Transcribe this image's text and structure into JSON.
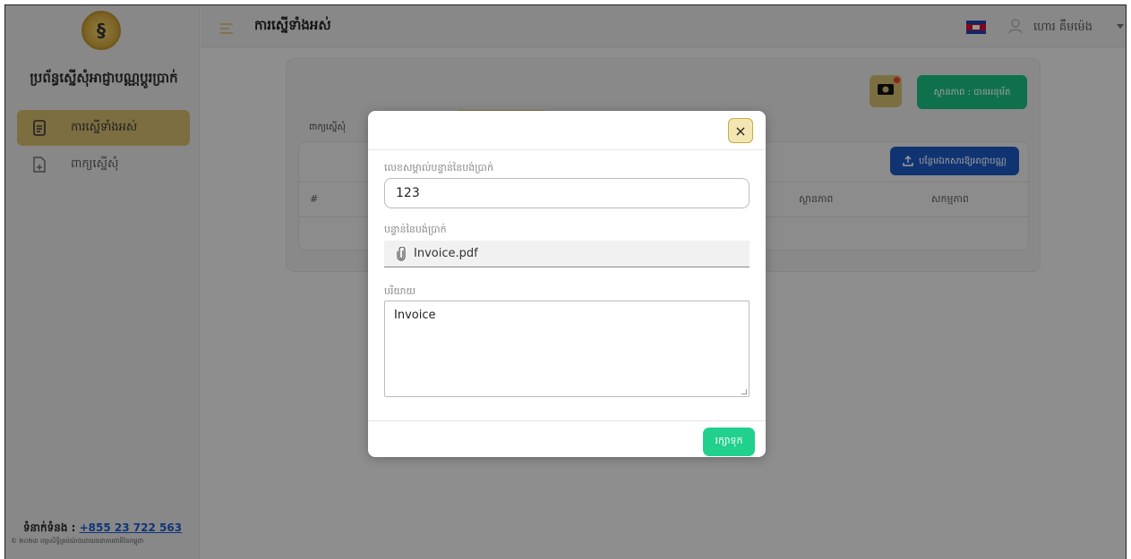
{
  "sidebar": {
    "logo_text": "§",
    "app_title": "ប្រព័ន្ធស្នើសុំអាជ្ញាបណ្ណប្តូរប្រាក់",
    "items": [
      {
        "label": "ការស្នើទាំងអស់",
        "icon": "document-icon",
        "active": true
      },
      {
        "label": "ពាក្យស្នើសុំ",
        "icon": "file-add-icon",
        "active": false
      }
    ],
    "contact_label": "ទំនាក់ទំនង : ",
    "contact_phone": "+855 23 722 563",
    "copyright": "© ២០២៣ រក្សាសិទ្ធិគ្រប់យ៉ាងដោយធនាគារជាតិនៃកម្ពុជា"
  },
  "topbar": {
    "title": "ការស្នើទាំងអស់",
    "user_name": "ហោរ គឹមម៉េង",
    "flag": "cambodia-flag-icon"
  },
  "card": {
    "status_button": "ស្ថានភាព : បានអនុម័ត",
    "tab_label": "ពាក្យស្នើសុំ",
    "upload_button": "បន្ថែមឯកសារឱ្យអាជ្ញាបណ្ណ",
    "columns": [
      "#",
      "ស្ថានភាព",
      "សកម្មភាព"
    ]
  },
  "modal": {
    "field1_label": "លេខសម្គាល់បន្ទាន់នៃបង់ប្រាក់",
    "field1_value": "123",
    "field2_label": "បន្ទាន់នៃបង់ប្រាក់",
    "file_name": "Invoice.pdf",
    "field3_label": "បរិយាយ",
    "description": "Invoice",
    "save_button": "រក្សាទុក",
    "close_symbol": "×"
  },
  "colors": {
    "accent_gold": "#c9b26a",
    "success_green": "#17b779",
    "primary_blue": "#1a55b8"
  }
}
